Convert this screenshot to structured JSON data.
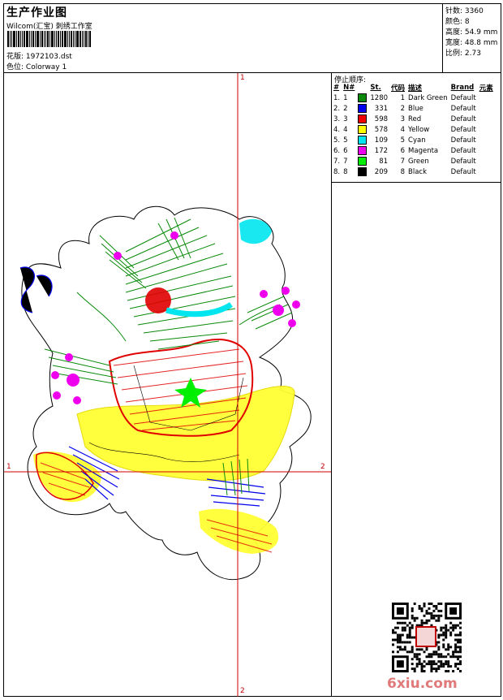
{
  "header": {
    "title": "生产作业图",
    "company": "Wilcom(汇宝) 刺绣工作室",
    "pattern_label": "花版:",
    "pattern_value": "1972103.dst",
    "colorway_label": "色位:",
    "colorway_value": "Colorway 1"
  },
  "stats": [
    {
      "label": "针数:",
      "value": "3360"
    },
    {
      "label": "颜色:",
      "value": "8"
    },
    {
      "label": "高度:",
      "value": "54.9 mm"
    },
    {
      "label": "宽度:",
      "value": "48.8 mm"
    },
    {
      "label": "比例:",
      "value": "2.73"
    }
  ],
  "stop_sequence": {
    "title": "停止顺序:",
    "columns": [
      "#",
      "N#",
      "St.",
      "代码",
      "描述",
      "Brand",
      "元素"
    ],
    "rows": [
      {
        "num": "1.",
        "n": "1",
        "color": "#0a8a0a",
        "st": "1280",
        "code": "1",
        "desc": "Dark Green",
        "brand": "Default"
      },
      {
        "num": "2.",
        "n": "2",
        "color": "#0000ee",
        "st": "331",
        "code": "2",
        "desc": "Blue",
        "brand": "Default"
      },
      {
        "num": "3.",
        "n": "3",
        "color": "#ee0000",
        "st": "598",
        "code": "3",
        "desc": "Red",
        "brand": "Default"
      },
      {
        "num": "4.",
        "n": "4",
        "color": "#ffff00",
        "st": "578",
        "code": "4",
        "desc": "Yellow",
        "brand": "Default"
      },
      {
        "num": "5.",
        "n": "5",
        "color": "#00e5ee",
        "st": "109",
        "code": "5",
        "desc": "Cyan",
        "brand": "Default"
      },
      {
        "num": "6.",
        "n": "6",
        "color": "#ee00ee",
        "st": "172",
        "code": "6",
        "desc": "Magenta",
        "brand": "Default"
      },
      {
        "num": "7.",
        "n": "7",
        "color": "#00ee00",
        "st": "81",
        "code": "7",
        "desc": "Green",
        "brand": "Default"
      },
      {
        "num": "8.",
        "n": "8",
        "color": "#000000",
        "st": "209",
        "code": "8",
        "desc": "Black",
        "brand": "Default"
      }
    ]
  },
  "axis_labels": {
    "top": "1",
    "bottom": "2",
    "left": "1",
    "right": "2"
  },
  "watermark": "6xiu.com",
  "icons": {
    "qr": "qr-code-icon",
    "seal": "seal-icon"
  }
}
